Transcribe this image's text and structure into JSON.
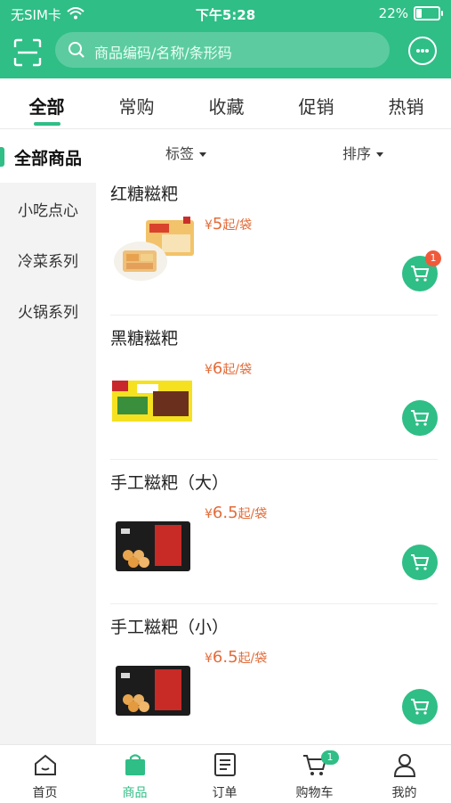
{
  "status_bar": {
    "carrier": "无SIM卡",
    "time": "下午5:28",
    "battery": "22%"
  },
  "search": {
    "placeholder": "商品编码/名称/条形码"
  },
  "tabs": [
    {
      "label": "全部",
      "active": true
    },
    {
      "label": "常购"
    },
    {
      "label": "收藏"
    },
    {
      "label": "促销"
    },
    {
      "label": "热销"
    }
  ],
  "sidebar": {
    "items": [
      {
        "label": "全部商品",
        "active": true
      },
      {
        "label": "小吃点心"
      },
      {
        "label": "冷菜系列"
      },
      {
        "label": "火锅系列"
      }
    ]
  },
  "filters": {
    "tag": "标签",
    "sort": "排序"
  },
  "products": [
    {
      "name": "红糖糍粑",
      "price_symbol": "¥",
      "price": "5",
      "price_unit": "起/袋",
      "cart_badge": "1"
    },
    {
      "name": "黑糖糍粑",
      "price_symbol": "¥",
      "price": "6",
      "price_unit": "起/袋"
    },
    {
      "name": "手工糍粑（大）",
      "price_symbol": "¥",
      "price": "6.5",
      "price_unit": "起/袋"
    },
    {
      "name": "手工糍粑（小）",
      "price_symbol": "¥",
      "price": "6.5",
      "price_unit": "起/袋"
    }
  ],
  "bottom_nav": [
    {
      "label": "首页"
    },
    {
      "label": "商品",
      "active": true
    },
    {
      "label": "订单"
    },
    {
      "label": "购物车",
      "badge": "1"
    },
    {
      "label": "我的"
    }
  ],
  "colors": {
    "accent": "#2fbe86",
    "price": "#e36c3a",
    "badge": "#f05a3a"
  }
}
